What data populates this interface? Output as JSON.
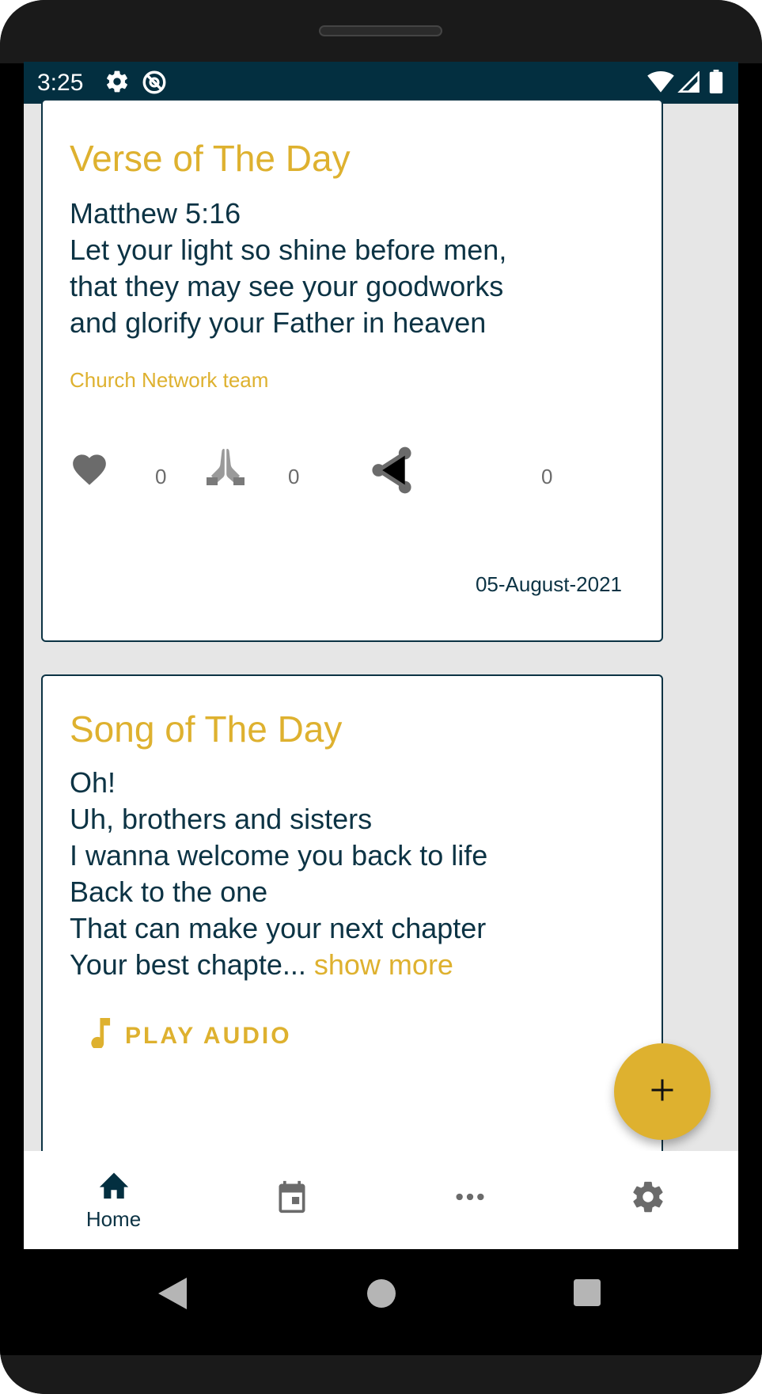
{
  "status_bar": {
    "time": "3:25",
    "icons": [
      "settings-gear-icon",
      "sync-disabled-icon",
      "wifi-icon",
      "signal-icon",
      "battery-icon"
    ]
  },
  "verse_card": {
    "title": "Verse of The Day",
    "text": "Matthew 5:16\nLet your light so shine before men,\nthat they may see your goodworks\nand glorify your Father in heaven",
    "author": "Church Network team",
    "like_count": "0",
    "pray_count": "0",
    "share_count": "0",
    "date": "05-August-2021"
  },
  "song_card": {
    "title": "Song of The Day",
    "text": "Oh!\nUh, brothers and sisters\nI wanna welcome you back to life\nBack to the one\nThat can make your next chapter\nYour best chapte... ",
    "show_more": "show more",
    "play_audio": "PLAY AUDIO"
  },
  "bottom_nav": {
    "items": [
      {
        "label": "Home",
        "icon": "home-icon"
      },
      {
        "label": "",
        "icon": "calendar-icon"
      },
      {
        "label": "",
        "icon": "more-horiz-icon"
      },
      {
        "label": "",
        "icon": "settings-icon"
      }
    ]
  },
  "colors": {
    "accent": "#deb12f",
    "primary_dark": "#032f40",
    "text": "#0c3344"
  }
}
